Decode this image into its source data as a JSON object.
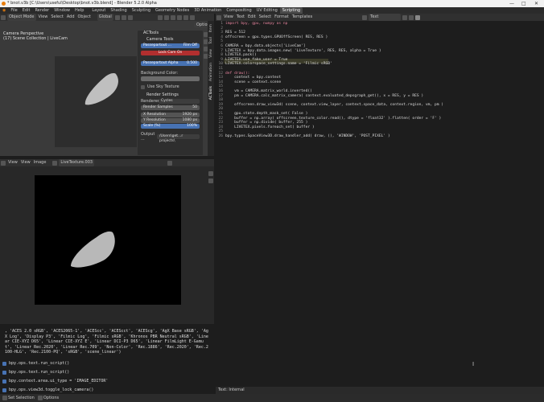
{
  "window": {
    "title": "* bnot.v3b [C:\\Users\\useful\\Desktop\\bnot.v3b.blend] - Blender 5.2.0 Alpha"
  },
  "menu": [
    "File",
    "Edit",
    "Render",
    "Window",
    "Help"
  ],
  "workspaces": [
    "Layout",
    "Modeling",
    "Sculpting",
    "UV Editing",
    "Texture Paint",
    "Shading",
    "Animation",
    "Rendering",
    "Compositing",
    "Geometry Nodes",
    "3D Animation",
    "Compositing",
    "UV Editing",
    "Scripting"
  ],
  "workspace_active": "Scripting",
  "viewport": {
    "mode": "Object Mode",
    "menus": [
      "View",
      "Select",
      "Add",
      "Object"
    ],
    "orientation": "Global",
    "overlay_line1": "Camera Perspective",
    "overlay_line2": "(17) Scene Collection | LiveCam",
    "options_label": "Options"
  },
  "actools": {
    "panel_title": "ACTools",
    "camera_tools_title": "Camera Tools",
    "passepartout_label": "Passepartout ...",
    "passepartout_state": "Film Off",
    "lock_cam_label": "Lock Cam On",
    "passepartout_alpha_label": "Passepartout Alpha",
    "passepartout_alpha_value": "0.500",
    "background_color_label": "Background Color:",
    "sky_texture_label": "Use Sky Texture",
    "render_settings_title": "Render Settings",
    "renderer_label": "Renderer:",
    "renderer_value": "Cycles",
    "render_samples_label": "Render Samples",
    "render_samples_value": "50",
    "x_res_label": "X Resolution",
    "x_res_value": "1920 px",
    "y_res_label": "Y Resolution",
    "y_res_value": "1080 px",
    "scale_label": "Scale (%)",
    "scale_value": "100%",
    "output_label": "Output ...",
    "output_value": "/Users\\get...r projects\\"
  },
  "side_tabs": [
    "Item",
    "Tool",
    "View",
    "Animation",
    "ACTools"
  ],
  "image_editor": {
    "menus": [
      "View",
      "View",
      "Image"
    ],
    "image_name": "LiveTexture.003"
  },
  "console": {
    "lines": [
      ", 'ACES 2.0 sRGB', 'ACES2065-1', 'ACEScc', 'ACEScct', 'ACEScg', 'AgX Base sRGB', 'AgX Log', 'Display P3', 'Filmic Log', 'Filmic sRGB', 'Khronos PBR Neutral sRGB', 'Linear CIE-XYZ D65', 'Linear CIE-XYZ E', 'Linear DCI-P3 D65', 'Linear FilmLight E-Gamut', 'Linear Rec.2020', 'Linear Rec.709', 'Non-Color', 'Rec.1886', 'Rec.2020', 'Rec.2100-HLG', 'Rec.2100-PQ', 'sRGB', 'scene_linear')"
    ],
    "history": [
      "bpy.ops.text.run_script()",
      "bpy.ops.text.run_script()",
      "bpy.context.area.ui_type = 'IMAGE_EDITOR'",
      "bpy.ops.view3d.toggle_lock_camera()"
    ]
  },
  "text_editor": {
    "menus": [
      "View",
      "Text",
      "Edit",
      "Select",
      "Format",
      "Templates"
    ],
    "file_name": "Text",
    "status": "Text: Internal",
    "code": [
      "import bpy, gpu, numpy as np",
      "",
      "RES = 512",
      "offscreen = gpu.types.GPUOffScreen( RES, RES )",
      "",
      "CAMERA = bpy.data.objects['LiveCam']",
      "LIVETEX = bpy.data.images.new( 'LiveTexture', RES, RES, alpha = True )",
      "LIVETEX.pack()",
      "LIVETEX.use_fake_user = True",
      "LIVETEX.colorspace_settings.name = 'Filmic sRGB'",
      "",
      "def draw():",
      "    context = bpy.context",
      "    scene = context.scene",
      "",
      "    vm = CAMERA.matrix_world.inverted()",
      "    pm = CAMERA.calc_matrix_camera( context.evaluated_depsgraph_get(), x = RES, y = RES )",
      "",
      "    offscreen.draw_view3d( scene, context.view_layer, context.space_data, context.region, vm, pm )",
      "",
      "    gpu.state.depth_mask_set( False )",
      "    buffer = np.array( offscreen.texture_color.read(), dtype = 'float32' ).flatten( order = 'F' )",
      "    buffer = np.divide( buffer, 255 )",
      "    LIVETEX.pixels.foreach_set( buffer )",
      "",
      "bpy.types.SpaceView3D.draw_handler_add( draw, (), 'WINDOW', 'POST_PIXEL' )"
    ],
    "line_numbers": [
      "1",
      "2",
      "3",
      "4",
      "5",
      "6",
      "7",
      "8",
      "9",
      "10",
      "11",
      "12",
      "13",
      "14",
      "15",
      "16",
      "17",
      "18",
      "19",
      "20",
      "21",
      "22",
      "23",
      "24",
      "25",
      "26"
    ]
  },
  "statusbar": {
    "left1": "Set Selection",
    "left2": "Options"
  },
  "colors": {
    "accent": "#4772b3",
    "danger": "#b22f2f",
    "keyword": "#e5839d",
    "string": "#e5c07b"
  }
}
